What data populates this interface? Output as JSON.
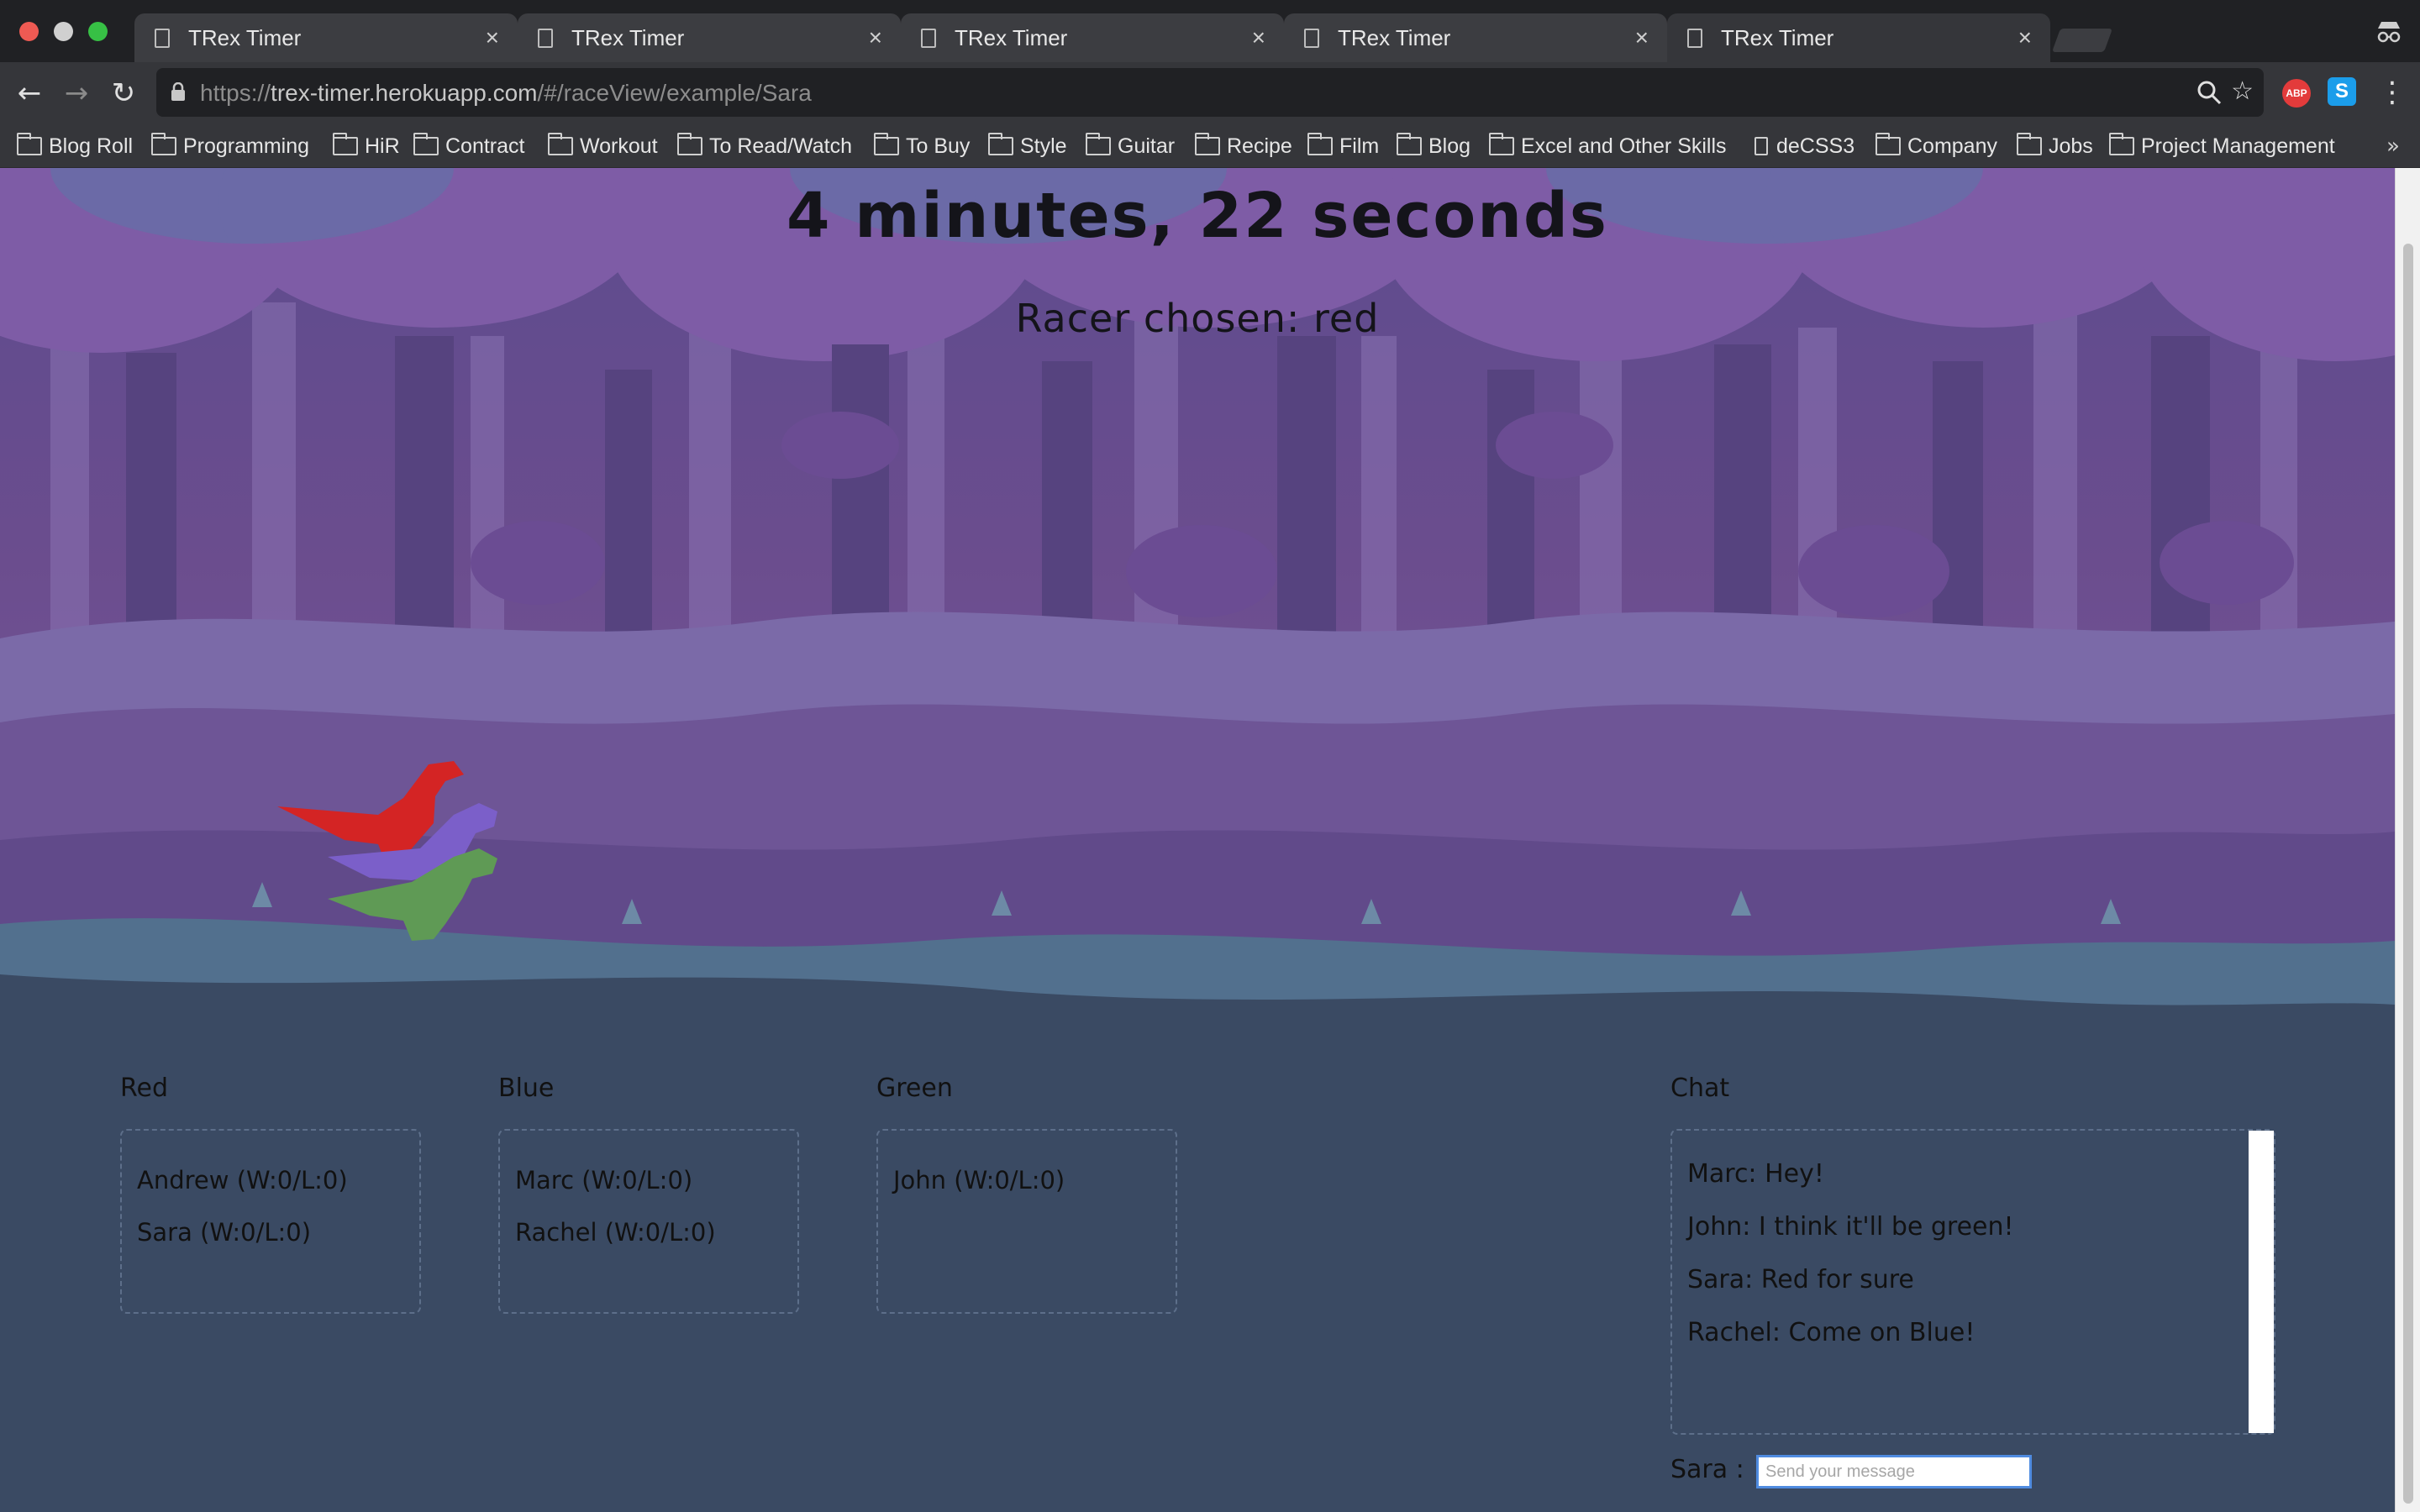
{
  "browser": {
    "tabs": [
      {
        "title": "TRex Timer",
        "active": false
      },
      {
        "title": "TRex Timer",
        "active": false
      },
      {
        "title": "TRex Timer",
        "active": false
      },
      {
        "title": "TRex Timer",
        "active": false
      },
      {
        "title": "TRex Timer",
        "active": true
      }
    ],
    "url": {
      "scheme": "https://",
      "host": "trex-timer.herokuapp.com",
      "path": "/#/raceView/example/Sara"
    },
    "extensions": {
      "adblock_label": "ABP",
      "skype_label": "S"
    },
    "bookmarks": [
      {
        "label": "Blog Roll",
        "type": "folder"
      },
      {
        "label": "Programming",
        "type": "folder"
      },
      {
        "label": "HiR",
        "type": "folder"
      },
      {
        "label": "Contract",
        "type": "folder"
      },
      {
        "label": "Workout",
        "type": "folder"
      },
      {
        "label": "To Read/Watch",
        "type": "folder"
      },
      {
        "label": "To Buy",
        "type": "folder"
      },
      {
        "label": "Style",
        "type": "folder"
      },
      {
        "label": "Guitar",
        "type": "folder"
      },
      {
        "label": "Recipe",
        "type": "folder"
      },
      {
        "label": "Film",
        "type": "folder"
      },
      {
        "label": "Blog",
        "type": "folder"
      },
      {
        "label": "Excel and Other Skills",
        "type": "folder"
      },
      {
        "label": "deCSS3",
        "type": "page"
      },
      {
        "label": "Company",
        "type": "folder"
      },
      {
        "label": "Jobs",
        "type": "folder"
      },
      {
        "label": "Project Management",
        "type": "folder"
      }
    ],
    "overflow_label": "»"
  },
  "race": {
    "timer": "4 minutes, 22 seconds",
    "racer_chosen": "Racer chosen: red",
    "dinos": [
      {
        "team": "red",
        "color": "#d42424"
      },
      {
        "team": "blue",
        "color": "#7b5fc9"
      },
      {
        "team": "green",
        "color": "#5f9a55"
      }
    ]
  },
  "teams": [
    {
      "name": "Red",
      "members": [
        "Andrew (W:0/L:0)",
        "Sara (W:0/L:0)"
      ]
    },
    {
      "name": "Blue",
      "members": [
        "Marc (W:0/L:0)",
        "Rachel (W:0/L:0)"
      ]
    },
    {
      "name": "Green",
      "members": [
        "John (W:0/L:0)"
      ]
    }
  ],
  "chat": {
    "title": "Chat",
    "messages": [
      "Marc: Hey!",
      "John: I think it'll be green!",
      "Sara: Red for sure",
      "Rachel: Come on Blue!"
    ],
    "user_label": "Sara :",
    "input_placeholder": "Send your message",
    "input_value": ""
  },
  "colors": {
    "sky": "#6a4a8c",
    "canopy": "#7c5aa0",
    "ground": "#3a4a63",
    "accent_input": "#4f8be0"
  }
}
